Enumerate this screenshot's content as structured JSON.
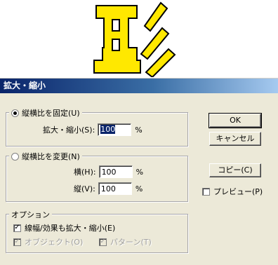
{
  "dialog": {
    "title": "拡大・縮小",
    "keep_ratio": {
      "label": "縦横比を固定(U)",
      "scale_label": "拡大・縮小(S):",
      "scale_value": "100",
      "unit": "%"
    },
    "change_ratio": {
      "label": "縦横比を変更(N)",
      "horizontal_label": "横(H):",
      "horizontal_value": "100",
      "vertical_label": "縦(V):",
      "vertical_value": "100",
      "unit": "%"
    },
    "options": {
      "label": "オプション",
      "scale_strokes_label": "線幅/効果も拡大・縮小(E)",
      "objects_label": "オブジェクト(O)",
      "patterns_label": "パターン(T)"
    },
    "buttons": {
      "ok": "OK",
      "cancel": "キャンセル",
      "copy": "コピー(C)"
    },
    "preview_label": "プレビュー(P)"
  },
  "colors": {
    "art_fill": "#ffe800",
    "titlebar_start": "#0a246a",
    "titlebar_end": "#a6caf0"
  }
}
